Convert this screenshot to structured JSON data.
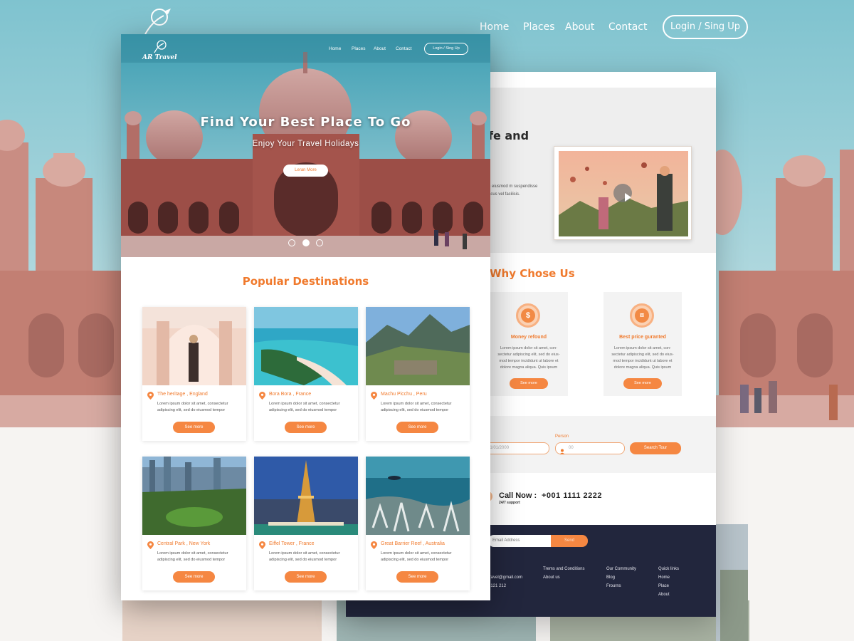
{
  "background": {
    "nav": {
      "links": [
        "Home",
        "Places",
        "About",
        "Contact"
      ],
      "login": "Login / Sing Up"
    }
  },
  "front_page": {
    "brand": "AR Travel",
    "nav": {
      "links": [
        "Home",
        "Places",
        "About",
        "Contact"
      ],
      "login": "Login / Sing Up"
    },
    "hero": {
      "title": "Find Your Best Place To Go",
      "subtitle": "Enjoy Your Travel Holidays",
      "button": "Leran More",
      "slide_count": 3,
      "active_slide": 2
    },
    "popular": {
      "title": "Popular Destinations",
      "cards": [
        {
          "name": "The heritage , England",
          "text": "Lorem ipsum dolor sit amet, consectetur adipiscing elit, sed do eiusmod tempor",
          "button": "See more"
        },
        {
          "name": "Bora Bora , France",
          "text": "Lorem ipsum dolor sit amet, consectetur adipiscing elit, sed do eiusmod tempor",
          "button": "See more"
        },
        {
          "name": "Machu Picchu , Peru",
          "text": "Lorem ipsum dolor sit amet, consectetur adipiscing elit, sed do eiusmod tempor",
          "button": "See more"
        },
        {
          "name": "Central Park , New York",
          "text": "Lorem ipsum dolor sit amet, consectetur adipiscing elit, sed do eiusmod tempor",
          "button": "See more"
        },
        {
          "name": "Eiffel Tower , France",
          "text": "Lorem ipsum dolor sit amet, consectetur adipiscing elit, sed do eiusmod tempor",
          "button": "See more"
        },
        {
          "name": "Great Barrier Reef , Australia",
          "text": "Lorem ipsum dolor sit amet, consectetur adipiscing elit, sed do eiusmod tempor",
          "button": "See more"
        }
      ]
    }
  },
  "back_page": {
    "about": {
      "title_fragment": "fe and",
      "text_fragment": "o eiusmod m suspendisse acus vel facilisis."
    },
    "why": {
      "title": "Why Chose Us",
      "features": [
        {
          "title": "Money refound",
          "icon": "dollar-icon",
          "icon_glyph": "$",
          "text": "Lorem ipsum dolor sit amet, con- sectetur adipiscing elit, sed do eius- mod tempor incididunt ut labore et dolore magna aliqua. Quis ipsum",
          "button": "See more"
        },
        {
          "title": "Best price guranted",
          "icon": "hand-coin-icon",
          "icon_glyph": "¤",
          "text": "Lorem ipsum dolor sit amet, con- sectetur adipiscing elit, sed do eius- mod tempor incididunt ut labore et dolore magna aliqua. Quis ipsum",
          "button": "See more"
        }
      ]
    },
    "search": {
      "date_label_fragment": "n",
      "date_value": "01/01/2000",
      "person_label": "Person",
      "person_value": "00",
      "button": "Search Tour"
    },
    "contact": {
      "call_label": "Call Now :",
      "number": "+001 1111 2222",
      "support": "24/7 support"
    },
    "footer": {
      "email_placeholder": "Email Address",
      "send": "Send",
      "col1": [
        "s",
        "travel@gmail.com",
        "2121 212"
      ],
      "col2": [
        "Trems and Conditions",
        "About us"
      ],
      "col3": [
        "Our Community",
        "Blog",
        "Frourns"
      ],
      "col4": [
        "Quick links",
        "Home",
        "Place",
        "About"
      ]
    }
  },
  "colors": {
    "accent": "#f58742",
    "accent_text": "#f07a2d",
    "footer_bg": "#22263d"
  }
}
